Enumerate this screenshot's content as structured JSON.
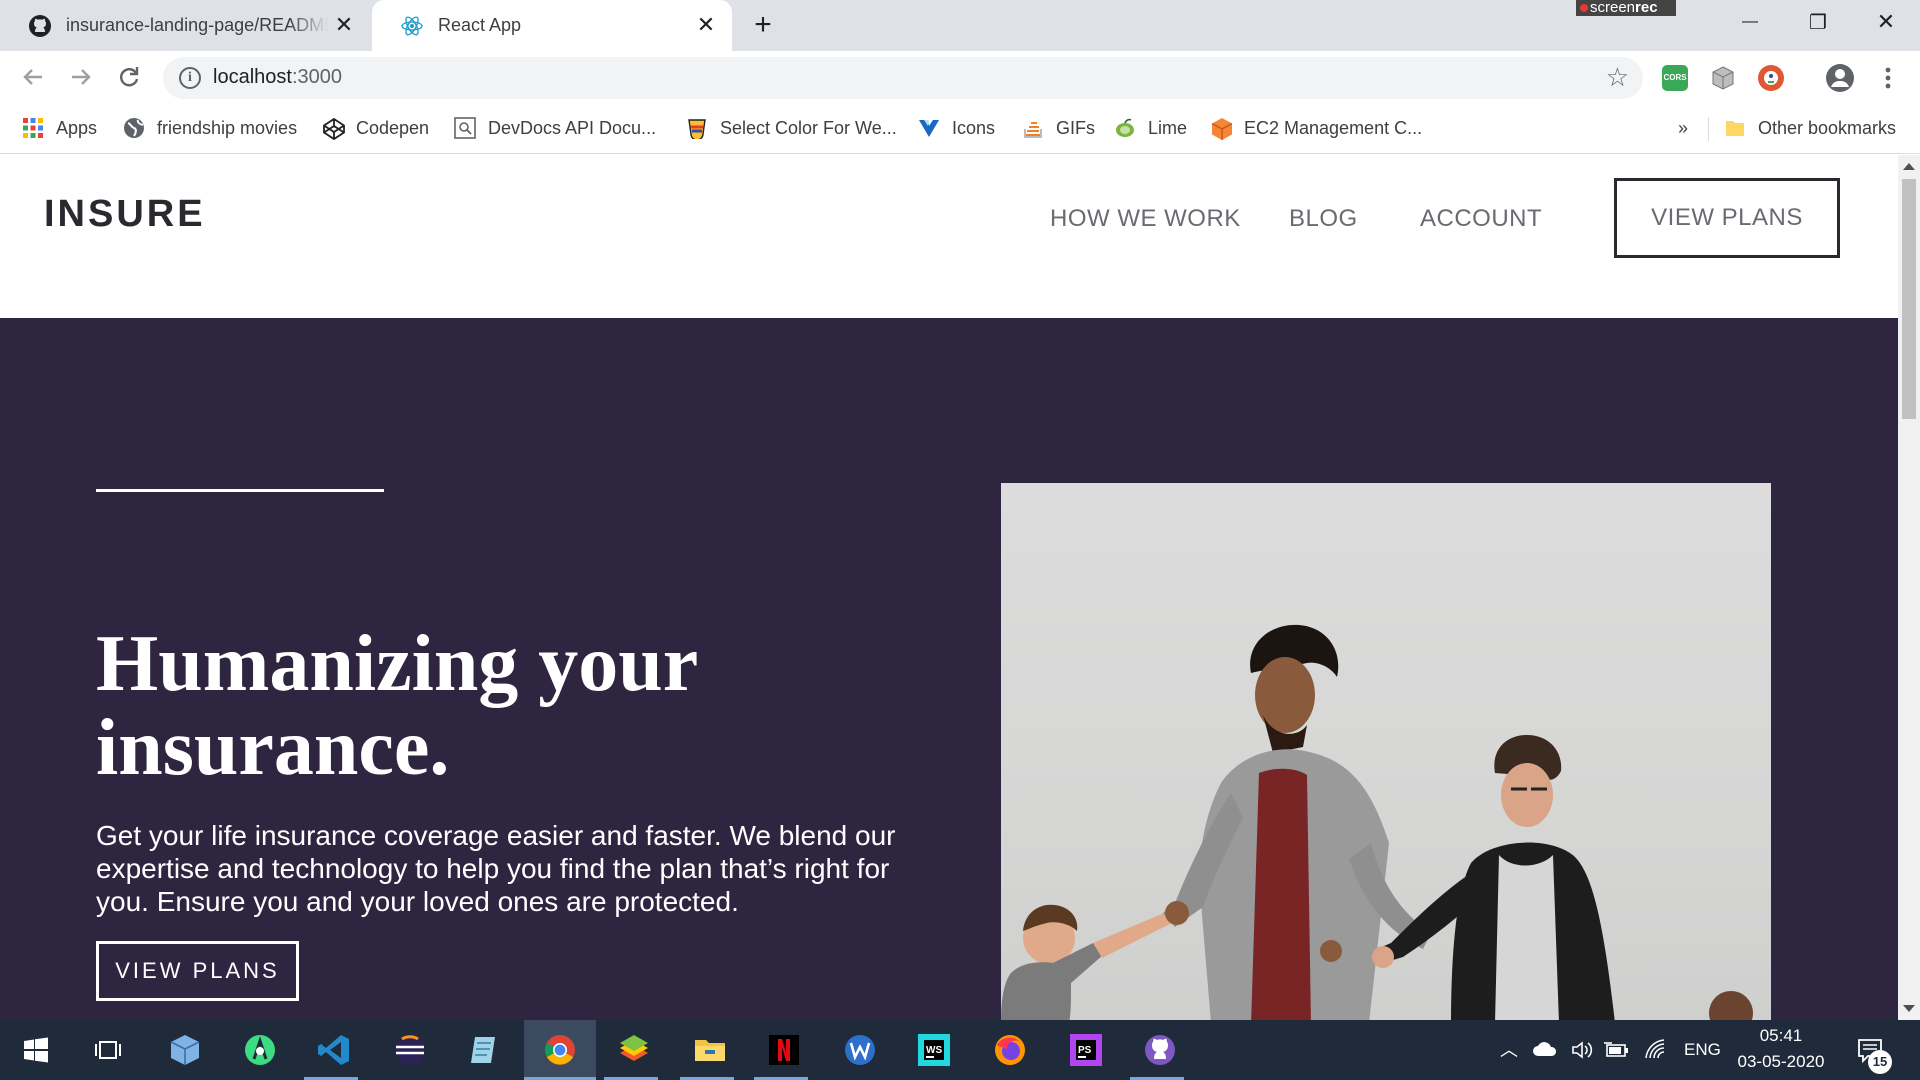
{
  "browser": {
    "tabs": [
      {
        "title": "insurance-landing-page/README.md at master",
        "icon": "github-icon",
        "active": false
      },
      {
        "title": "React App",
        "icon": "react-icon",
        "active": true
      }
    ],
    "new_tab": "+",
    "recorder_badge": {
      "prefix": "screen",
      "suffix": "rec"
    },
    "url_host": "localhost",
    "url_port": ":3000",
    "extensions": [
      "cors-extension-icon",
      "cube-extension-icon",
      "duckduckgo-extension-icon"
    ],
    "window_controls": {
      "minimize": "—",
      "restore": "❐",
      "close": "✕"
    }
  },
  "bookmarks": {
    "items": [
      {
        "label": "Apps",
        "icon": "apps-grid-icon"
      },
      {
        "label": "friendship movies",
        "icon": "globe-icon"
      },
      {
        "label": "Codepen",
        "icon": "codepen-icon"
      },
      {
        "label": "DevDocs API Docu...",
        "icon": "devdocs-icon"
      },
      {
        "label": "Select Color For We...",
        "icon": "color-picker-icon"
      },
      {
        "label": "Icons",
        "icon": "vuetify-icon"
      },
      {
        "label": "GIFs",
        "icon": "gifs-icon"
      },
      {
        "label": "Lime",
        "icon": "lime-icon"
      },
      {
        "label": "EC2 Management C...",
        "icon": "aws-icon"
      }
    ],
    "overflow": "»",
    "other": "Other bookmarks"
  },
  "site": {
    "logo": "INSURE",
    "nav": [
      "HOW WE WORK",
      "BLOG",
      "ACCOUNT"
    ],
    "cta": "VIEW PLANS"
  },
  "hero": {
    "title": "Humanizing your insurance.",
    "text": "Get your life insurance coverage easier and faster. We blend our expertise and technology to help you find the plan that’s right for you. Ensure you and your loved ones are protected.",
    "cta": "VIEW PLANS",
    "background": "#2e2640"
  },
  "taskbar": {
    "apps": [
      "windows-start-icon",
      "task-view-icon",
      "virtualbox-icon",
      "android-studio-icon",
      "vscode-icon",
      "eclipse-icon",
      "notepad-icon",
      "chrome-icon",
      "bluestacks-icon",
      "file-explorer-icon",
      "netflix-icon",
      "wps-writer-icon",
      "webstorm-icon",
      "firefox-icon",
      "phpstorm-icon",
      "github-desktop-icon"
    ],
    "language": "ENG",
    "time": "05:41",
    "date": "03-05-2020",
    "notifications": "15"
  }
}
